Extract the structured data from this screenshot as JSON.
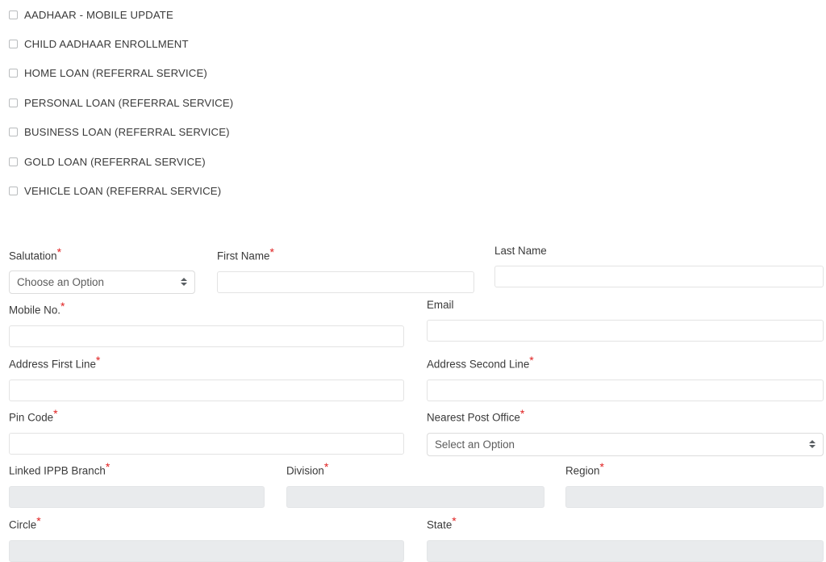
{
  "services": {
    "items": [
      {
        "label": "AADHAAR - MOBILE UPDATE",
        "checked": false
      },
      {
        "label": "CHILD AADHAAR ENROLLMENT",
        "checked": false
      },
      {
        "label": "HOME LOAN (REFERRAL SERVICE)",
        "checked": false
      },
      {
        "label": "PERSONAL LOAN (REFERRAL SERVICE)",
        "checked": false
      },
      {
        "label": "BUSINESS LOAN (REFERRAL SERVICE)",
        "checked": false
      },
      {
        "label": "GOLD LOAN (REFERRAL SERVICE)",
        "checked": false
      },
      {
        "label": "VEHICLE LOAN (REFERRAL SERVICE)",
        "checked": false
      }
    ]
  },
  "form": {
    "required_marker": "*",
    "salutation": {
      "label": "Salutation",
      "required": true,
      "selected": "Choose an Option",
      "value": ""
    },
    "first_name": {
      "label": "First Name",
      "required": true,
      "value": "",
      "placeholder": ""
    },
    "last_name": {
      "label": "Last Name",
      "required": false,
      "value": "",
      "placeholder": ""
    },
    "mobile_no": {
      "label": "Mobile No.",
      "required": true,
      "value": "",
      "placeholder": ""
    },
    "email": {
      "label": "Email",
      "required": false,
      "value": "",
      "placeholder": ""
    },
    "address_first_line": {
      "label": "Address First Line",
      "required": true,
      "value": "",
      "placeholder": ""
    },
    "address_second_line": {
      "label": "Address Second Line",
      "required": true,
      "value": "",
      "placeholder": ""
    },
    "pin_code": {
      "label": "Pin Code",
      "required": true,
      "value": "",
      "placeholder": ""
    },
    "nearest_post_office": {
      "label": "Nearest Post Office",
      "required": true,
      "selected": "Select an Option",
      "value": ""
    },
    "linked_ippb_branch": {
      "label": "Linked IPPB Branch",
      "required": true,
      "value": "",
      "disabled": true
    },
    "division": {
      "label": "Division",
      "required": true,
      "value": "",
      "disabled": true
    },
    "region": {
      "label": "Region",
      "required": true,
      "value": "",
      "disabled": true
    },
    "circle": {
      "label": "Circle",
      "required": true,
      "value": "",
      "disabled": true
    },
    "state": {
      "label": "State",
      "required": true,
      "value": "",
      "disabled": true
    }
  },
  "colors": {
    "required_asterisk": "#e02020",
    "text": "#3a3a3a",
    "input_border": "#e3e3e3",
    "disabled_fill": "#e9ebed",
    "page_background": "#ffffff"
  },
  "icons": {
    "stepper": "updown-stepper-icon",
    "checkbox": "checkbox-icon"
  }
}
